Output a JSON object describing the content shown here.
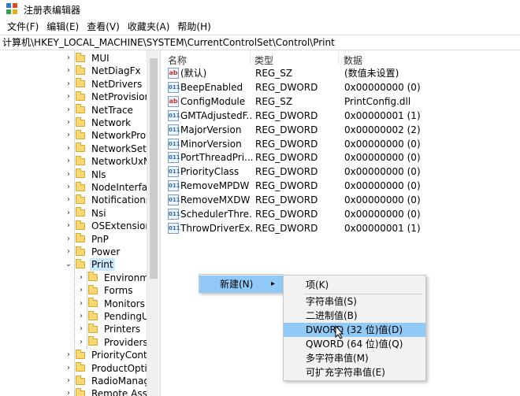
{
  "window": {
    "title": "注册表编辑器",
    "icon_colors": [
      "#2e7bd6",
      "#d84a2b",
      "#3aa14a",
      "#e0b020"
    ]
  },
  "menu": [
    "文件(F)",
    "编辑(E)",
    "查看(V)",
    "收藏夹(A)",
    "帮助(H)"
  ],
  "address": "计算机\\HKEY_LOCAL_MACHINE\\SYSTEM\\CurrentControlSet\\Control\\Print",
  "tree": {
    "items": [
      {
        "label": "MUI",
        "level": 0,
        "expanded": false
      },
      {
        "label": "NetDiagFx",
        "level": 0,
        "expanded": false
      },
      {
        "label": "NetDrivers",
        "level": 0,
        "expanded": false
      },
      {
        "label": "NetProvision",
        "level": 0,
        "expanded": false
      },
      {
        "label": "NetTrace",
        "level": 0,
        "expanded": false
      },
      {
        "label": "Network",
        "level": 0,
        "expanded": false
      },
      {
        "label": "NetworkProv",
        "level": 0,
        "expanded": false
      },
      {
        "label": "NetworkSetu",
        "level": 0,
        "expanded": false
      },
      {
        "label": "NetworkUxM",
        "level": 0,
        "expanded": false
      },
      {
        "label": "Nls",
        "level": 0,
        "expanded": false
      },
      {
        "label": "NodeInterfac",
        "level": 0,
        "expanded": false
      },
      {
        "label": "Notifications",
        "level": 0,
        "expanded": false
      },
      {
        "label": "Nsi",
        "level": 0,
        "expanded": false
      },
      {
        "label": "OSExtensionD",
        "level": 0,
        "expanded": false
      },
      {
        "label": "PnP",
        "level": 0,
        "expanded": false
      },
      {
        "label": "Power",
        "level": 0,
        "expanded": false
      },
      {
        "label": "Print",
        "level": 0,
        "expanded": true,
        "selected": true
      },
      {
        "label": "Environme",
        "level": 1,
        "expanded": false
      },
      {
        "label": "Forms",
        "level": 1,
        "expanded": false
      },
      {
        "label": "Monitors",
        "level": 1,
        "expanded": false
      },
      {
        "label": "PendingUp",
        "level": 1,
        "expanded": false
      },
      {
        "label": "Printers",
        "level": 1,
        "expanded": false
      },
      {
        "label": "Providers",
        "level": 1,
        "expanded": false
      },
      {
        "label": "PriorityControl",
        "level": 0,
        "expanded": false
      },
      {
        "label": "ProductOptic",
        "level": 0,
        "expanded": false
      },
      {
        "label": "RadioManage",
        "level": 0,
        "expanded": false
      },
      {
        "label": "Remote Assis",
        "level": 0,
        "expanded": false
      }
    ]
  },
  "list": {
    "headers": {
      "name": "名称",
      "type": "类型",
      "data": "数据"
    },
    "rows": [
      {
        "name": "(默认)",
        "type": "REG_SZ",
        "data": "(数值未设置)",
        "icon": "string-value-icon"
      },
      {
        "name": "BeepEnabled",
        "type": "REG_DWORD",
        "data": "0x00000000 (0)",
        "icon": "binary-value-icon"
      },
      {
        "name": "ConfigModule",
        "type": "REG_SZ",
        "data": "PrintConfig.dll",
        "icon": "string-value-icon"
      },
      {
        "name": "GMTAdjustedF...",
        "type": "REG_DWORD",
        "data": "0x00000001 (1)",
        "icon": "binary-value-icon"
      },
      {
        "name": "MajorVersion",
        "type": "REG_DWORD",
        "data": "0x00000002 (2)",
        "icon": "binary-value-icon"
      },
      {
        "name": "MinorVersion",
        "type": "REG_DWORD",
        "data": "0x00000000 (0)",
        "icon": "binary-value-icon"
      },
      {
        "name": "PortThreadPri...",
        "type": "REG_DWORD",
        "data": "0x00000000 (0)",
        "icon": "binary-value-icon"
      },
      {
        "name": "PriorityClass",
        "type": "REG_DWORD",
        "data": "0x00000000 (0)",
        "icon": "binary-value-icon"
      },
      {
        "name": "RemoveMPDW",
        "type": "REG_DWORD",
        "data": "0x00000000 (0)",
        "icon": "binary-value-icon"
      },
      {
        "name": "RemoveMXDW",
        "type": "REG_DWORD",
        "data": "0x00000000 (0)",
        "icon": "binary-value-icon"
      },
      {
        "name": "SchedulerThre...",
        "type": "REG_DWORD",
        "data": "0x00000000 (0)",
        "icon": "binary-value-icon"
      },
      {
        "name": "ThrowDriverEx...",
        "type": "REG_DWORD",
        "data": "0x00000001 (1)",
        "icon": "binary-value-icon"
      }
    ]
  },
  "context_menu": {
    "new_label": "新建(N)",
    "submenu": {
      "items": [
        "项(K)",
        "字符串值(S)",
        "二进制值(B)",
        "DWORD (32 位)值(D)",
        "QWORD (64 位)值(Q)",
        "多字符串值(M)",
        "可扩充字符串值(E)"
      ],
      "hovered": "DWORD (32 位)值(D)"
    }
  },
  "colors": {
    "selection": "#cce8ff",
    "menu_hover": "#91c9f7",
    "folder": "#f8d775"
  }
}
